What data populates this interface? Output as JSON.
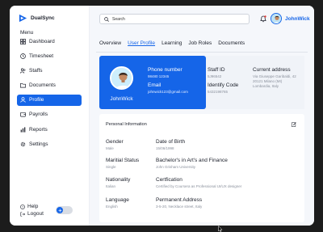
{
  "brand": {
    "name": "DualSync"
  },
  "sidebar": {
    "menu_title": "Menu",
    "items": [
      {
        "label": "Dashboard",
        "icon": "grid-icon"
      },
      {
        "label": "Timesheet",
        "icon": "clock-icon"
      },
      {
        "label": "Staffs",
        "icon": "users-icon"
      },
      {
        "label": "Documents",
        "icon": "folder-icon"
      },
      {
        "label": "Profile",
        "icon": "user-icon",
        "active": true
      },
      {
        "label": "Payrolls",
        "icon": "wallet-icon"
      },
      {
        "label": "Reports",
        "icon": "chart-icon"
      },
      {
        "label": "Settings",
        "icon": "gear-icon"
      }
    ],
    "help_label": "Help",
    "logout_label": "Logout"
  },
  "header": {
    "search_placeholder": "Search",
    "user_name": "JohnWick"
  },
  "tabs": [
    "Overview",
    "User Profile",
    "Learning",
    "Job Roles",
    "Documents"
  ],
  "active_tab": "User Profile",
  "profile_card": {
    "name": "JohnWick",
    "phone_label": "Phone number",
    "phone_value": "98480 12345",
    "email_label": "Email",
    "email_value": "johnwick123@gmail.com"
  },
  "meta": {
    "staff_id_label": "Staff ID",
    "staff_id_value": "5J96542",
    "identify_code_label": "Identify Code",
    "identify_code_value": "5432198765",
    "address_label": "Current address",
    "address_line1": "Via Giuseppe Garibaldi, 42",
    "address_line2": "20121 Milano (MI)",
    "address_line3": "Lombardia, Italy"
  },
  "personal": {
    "title": "Personal Information",
    "gender_label": "Gender",
    "gender_value": "Male",
    "dob_label": "Date of Birth",
    "dob_value": "15/06/1998",
    "marital_label": "Maritial Status",
    "marital_value": "Single",
    "degree_label": "Bachelor's in Art's and Finance",
    "degree_value": "John Grisham University",
    "nationality_label": "Nationality",
    "nationality_value": "Italian",
    "cert_label": "Certfication",
    "cert_value": "Certified by Coursera as Professional UI/UX designer",
    "language_label": "Language",
    "language_value": "English",
    "perm_address_label": "Permanent Address",
    "perm_address_value": "3-5-20, Necklace street, Italy"
  },
  "colors": {
    "accent": "#1565e8",
    "background": "#f5f7fb",
    "text": "#1b1f2a",
    "muted": "#8a909c"
  }
}
